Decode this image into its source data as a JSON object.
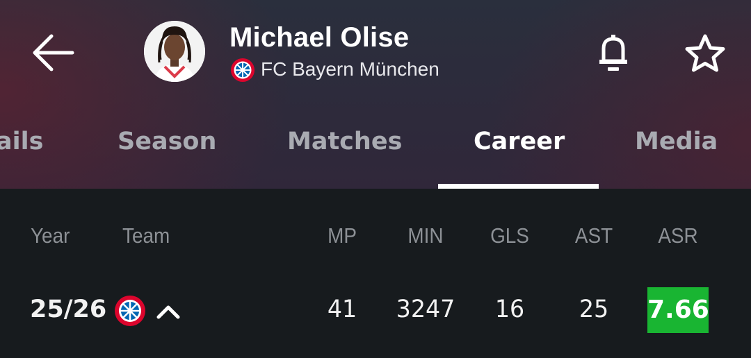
{
  "header": {
    "player_name": "Michael Olise",
    "club_name": "FC Bayern München",
    "club_logo_text": "FC BAYERN MÜNCHEN",
    "club_colors": {
      "primary": "#dc052d",
      "secondary": "#0066b2"
    }
  },
  "tabs": [
    {
      "label": "ails",
      "active": false
    },
    {
      "label": "Season",
      "active": false
    },
    {
      "label": "Matches",
      "active": false
    },
    {
      "label": "Career",
      "active": true
    },
    {
      "label": "Media",
      "active": false
    }
  ],
  "table": {
    "headers": {
      "year": "Year",
      "team": "Team",
      "mp": "MP",
      "min": "MIN",
      "gls": "GLS",
      "ast": "AST",
      "asr": "ASR"
    },
    "rows": [
      {
        "year": "25/26",
        "team_logo": "fc-bayern-logo",
        "expanded": true,
        "mp": "41",
        "min": "3247",
        "gls": "16",
        "ast": "25",
        "asr": "7.66",
        "asr_color": "#19b532"
      }
    ]
  },
  "colors": {
    "accent": "#ffffff",
    "rating_green": "#19b532",
    "background": "#171b1e"
  }
}
